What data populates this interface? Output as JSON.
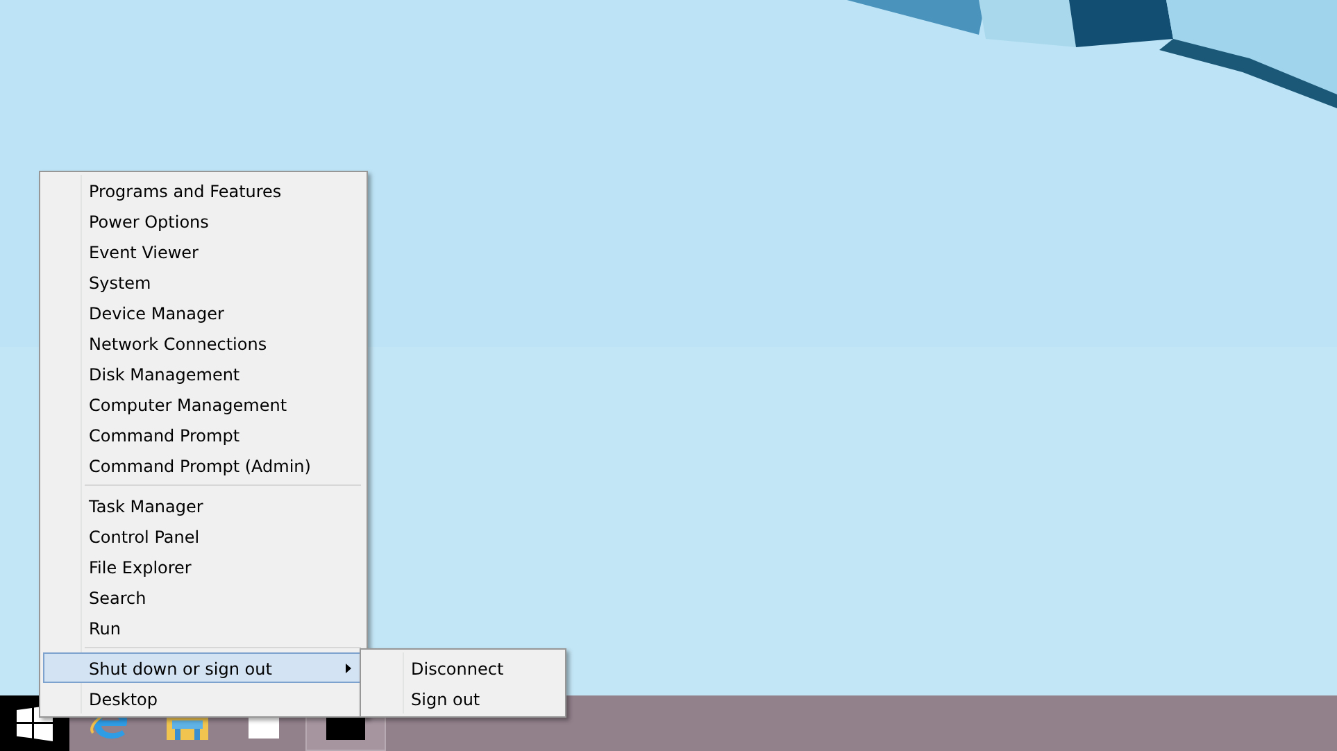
{
  "context_menu": {
    "sections": [
      {
        "items": [
          {
            "label": "Programs and Features",
            "selected": false
          },
          {
            "label": "Power Options",
            "selected": false
          },
          {
            "label": "Event Viewer",
            "selected": false
          },
          {
            "label": "System",
            "selected": false
          },
          {
            "label": "Device Manager",
            "selected": false
          },
          {
            "label": "Network Connections",
            "selected": false
          },
          {
            "label": "Disk Management",
            "selected": false
          },
          {
            "label": "Computer Management",
            "selected": false
          },
          {
            "label": "Command Prompt",
            "selected": false
          },
          {
            "label": "Command Prompt (Admin)",
            "selected": false
          }
        ]
      },
      {
        "items": [
          {
            "label": "Task Manager",
            "selected": false
          },
          {
            "label": "Control Panel",
            "selected": false
          },
          {
            "label": "File Explorer",
            "selected": false
          },
          {
            "label": "Search",
            "selected": false
          },
          {
            "label": "Run",
            "selected": false
          }
        ]
      },
      {
        "items": [
          {
            "label": "Shut down or sign out",
            "selected": true,
            "submenu": true
          },
          {
            "label": "Desktop",
            "selected": false
          }
        ]
      }
    ]
  },
  "submenu": {
    "items": [
      {
        "label": "Disconnect"
      },
      {
        "label": "Sign out"
      }
    ]
  },
  "taskbar": {
    "items": [
      {
        "kind": "start",
        "active": false
      },
      {
        "kind": "browser",
        "active": false
      },
      {
        "kind": "folder",
        "active": false
      },
      {
        "kind": "blank",
        "active": false
      },
      {
        "kind": "console",
        "active": true
      }
    ]
  }
}
